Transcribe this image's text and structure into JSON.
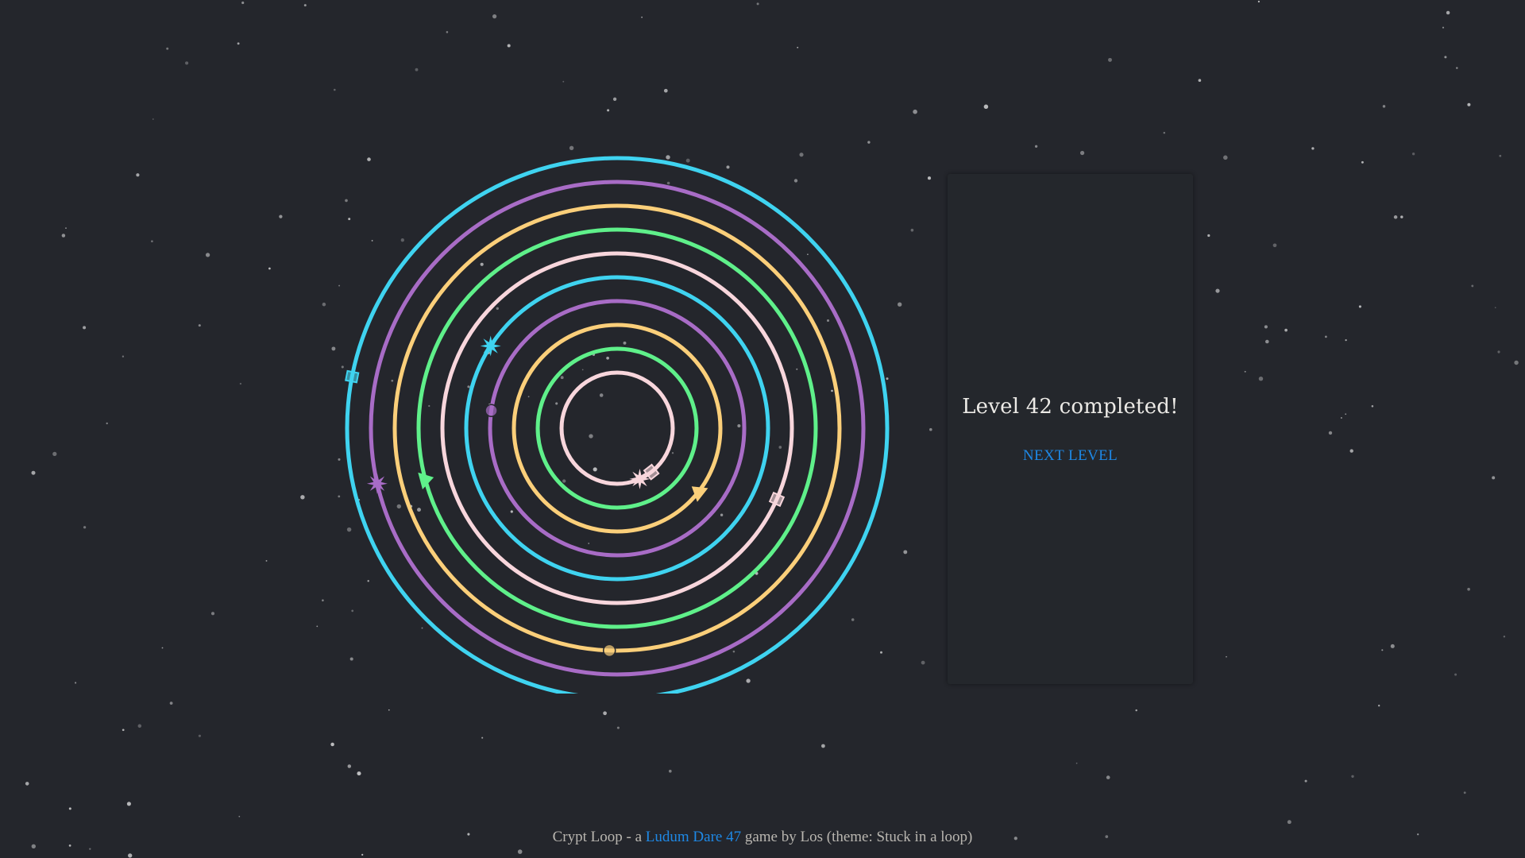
{
  "panel": {
    "title": "Level 42 completed!",
    "next_level_label": "NEXT LEVEL"
  },
  "footer": {
    "prefix": "Crypt Loop - a ",
    "link_label": "Ludum Dare 47",
    "suffix": " game by Los (theme: Stuck in a loop)"
  },
  "colors": {
    "background": "#24262c",
    "panel_bg": "#24272c",
    "link": "#1e88e5",
    "ring_cyan": "#3fd3f0",
    "ring_purple": "#a86cc6",
    "ring_yellow": "#fbcf7a",
    "ring_green": "#5ff08a",
    "ring_pink": "#f8d6dc"
  },
  "rings": [
    {
      "name": "ring-1",
      "color": "#3fd3f0"
    },
    {
      "name": "ring-2",
      "color": "#a86cc6"
    },
    {
      "name": "ring-3",
      "color": "#fbcf7a"
    },
    {
      "name": "ring-4",
      "color": "#5ff08a"
    },
    {
      "name": "ring-5",
      "color": "#f8d6dc"
    },
    {
      "name": "ring-6",
      "color": "#3fd3f0"
    },
    {
      "name": "ring-7",
      "color": "#a86cc6"
    },
    {
      "name": "ring-8",
      "color": "#fbcf7a"
    },
    {
      "name": "ring-9",
      "color": "#5ff08a"
    },
    {
      "name": "ring-10",
      "color": "#f8d6dc"
    }
  ],
  "tokens": [
    {
      "name": "cyan-square-token",
      "shape": "square"
    },
    {
      "name": "purple-star-token",
      "shape": "star"
    },
    {
      "name": "green-triangle-token",
      "shape": "triangle"
    },
    {
      "name": "cyan-star-token",
      "shape": "star"
    },
    {
      "name": "purple-circle-token",
      "shape": "circle"
    },
    {
      "name": "green-square-token",
      "shape": "square"
    },
    {
      "name": "pink-star-token",
      "shape": "star"
    },
    {
      "name": "yellow-triangle-token",
      "shape": "triangle"
    },
    {
      "name": "pink-square-token",
      "shape": "square"
    },
    {
      "name": "yellow-circle-token",
      "shape": "circle"
    }
  ]
}
